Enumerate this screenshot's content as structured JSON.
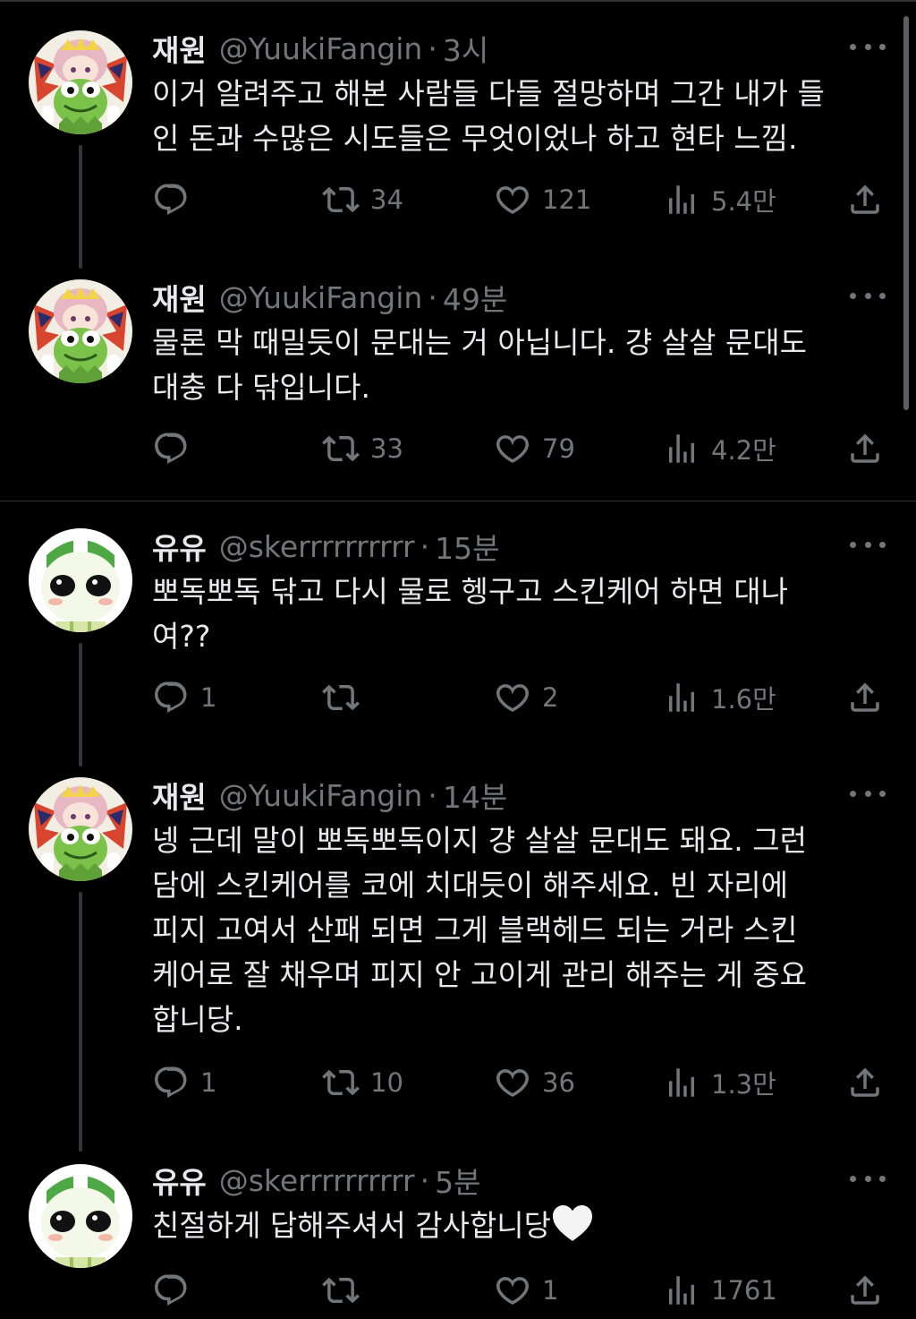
{
  "tweets": [
    {
      "name": "재원",
      "handle": "@YuukiFangin",
      "separator": "·",
      "time": "3시",
      "lines": [
        "이거 알려주고 해본 사람들 다들 절망하며 그간 내가 들",
        "인 돈과 수많은 시도들은 무엇이었나 하고 현타 느낌."
      ],
      "replies": "",
      "retweets": "34",
      "likes": "121",
      "views": "5.4만"
    },
    {
      "name": "재원",
      "handle": "@YuukiFangin",
      "separator": "·",
      "time": "49분",
      "lines": [
        "물론 막 때밀듯이 문대는 거 아닙니다. 걍 살살 문대도",
        "대충 다 닦입니다."
      ],
      "replies": "",
      "retweets": "33",
      "likes": "79",
      "views": "4.2만"
    },
    {
      "name": "유유",
      "handle": "@skerrrrrrrrrr",
      "separator": "·",
      "time": "15분",
      "lines": [
        "뽀독뽀독 닦고 다시 물로 헹구고 스킨케어 하면 대나",
        "여??"
      ],
      "replies": "1",
      "retweets": "",
      "likes": "2",
      "views": "1.6만"
    },
    {
      "name": "재원",
      "handle": "@YuukiFangin",
      "separator": "·",
      "time": "14분",
      "lines": [
        "넹 근데 말이 뽀독뽀독이지 걍 살살 문대도 돼요. 그런",
        "담에 스킨케어를 코에 치대듯이 해주세요. 빈 자리에",
        "피지 고여서 산패 되면 그게 블랙헤드 되는 거라 스킨",
        "케어로 잘 채우며 피지 안 고이게 관리 해주는 게 중요",
        "합니당."
      ],
      "replies": "1",
      "retweets": "10",
      "likes": "36",
      "views": "1.3만"
    },
    {
      "name": "유유",
      "handle": "@skerrrrrrrrrr",
      "separator": "·",
      "time": "5분",
      "lines": [
        "친절하게 답해주셔서 감사합니당"
      ],
      "emoji": "white-heart",
      "replies": "",
      "retweets": "",
      "likes": "1",
      "views": "1761"
    }
  ],
  "colors": {
    "background": "#000000",
    "text": "#e7e9ea",
    "muted": "#71767b",
    "divider": "#2f3336"
  },
  "icons": [
    "reply-icon",
    "retweet-icon",
    "like-icon",
    "views-icon",
    "share-icon",
    "more-icon"
  ]
}
